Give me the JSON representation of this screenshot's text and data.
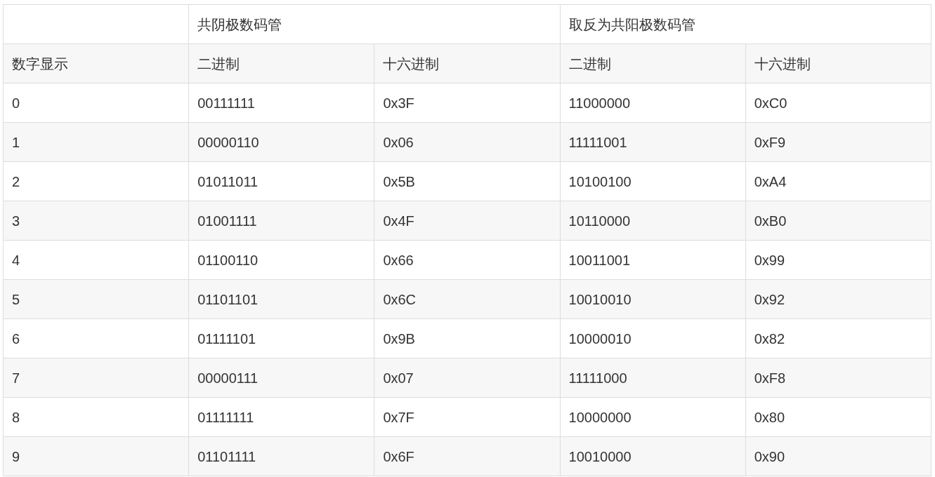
{
  "table": {
    "groups": [
      {
        "label": "共阴极数码管"
      },
      {
        "label": "取反为共阳极数码管"
      }
    ],
    "columns": [
      "数字显示",
      "二进制",
      "十六进制",
      "二进制",
      "十六进制"
    ],
    "rows": [
      [
        "0",
        "00111111",
        "0x3F",
        "11000000",
        "0xC0"
      ],
      [
        "1",
        "00000110",
        "0x06",
        "11111001",
        "0xF9"
      ],
      [
        "2",
        "01011011",
        "0x5B",
        "10100100",
        "0xA4"
      ],
      [
        "3",
        "01001111",
        "0x4F",
        "10110000",
        "0xB0"
      ],
      [
        "4",
        "01100110",
        "0x66",
        "10011001",
        "0x99"
      ],
      [
        "5",
        "01101101",
        "0x6C",
        "10010010",
        "0x92"
      ],
      [
        "6",
        "01111101",
        "0x9B",
        "10000010",
        "0x82"
      ],
      [
        "7",
        "00000111",
        "0x07",
        "11111000",
        "0xF8"
      ],
      [
        "8",
        "01111111",
        "0x7F",
        "10000000",
        "0x80"
      ],
      [
        "9",
        "01101111",
        "0x6F",
        "10010000",
        "0x90"
      ]
    ]
  }
}
